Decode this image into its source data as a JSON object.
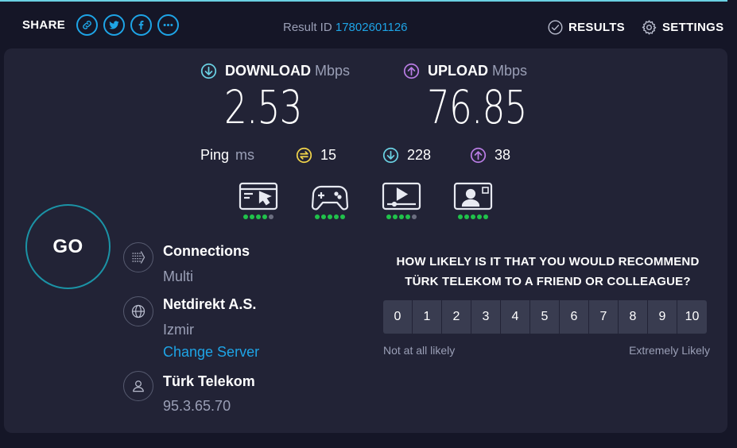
{
  "header": {
    "share_label": "SHARE",
    "share_buttons": [
      "link-icon",
      "twitter-icon",
      "facebook-icon",
      "more-icon"
    ],
    "result_id_label": "Result ID",
    "result_id": "17802601126",
    "results_label": "RESULTS",
    "settings_label": "SETTINGS"
  },
  "download": {
    "label": "DOWNLOAD",
    "unit": "Mbps",
    "value": "2.53",
    "icon": "download-arrow-icon",
    "color": "#6ad1e3"
  },
  "upload": {
    "label": "UPLOAD",
    "unit": "Mbps",
    "value": "76.85",
    "icon": "upload-arrow-icon",
    "color": "#b87ce3"
  },
  "ping": {
    "label": "Ping",
    "unit": "ms",
    "idle": "15",
    "download": "228",
    "upload": "38",
    "idle_color": "#f1d44a"
  },
  "use_cases": [
    {
      "icon": "browsing-icon",
      "rating": 4,
      "max": 5
    },
    {
      "icon": "gaming-icon",
      "rating": 5,
      "max": 5
    },
    {
      "icon": "video-streaming-icon",
      "rating": 4,
      "max": 5
    },
    {
      "icon": "video-chat-icon",
      "rating": 5,
      "max": 5
    }
  ],
  "go_label": "GO",
  "connections": {
    "title": "Connections",
    "value": "Multi"
  },
  "server": {
    "name": "Netdirekt A.S.",
    "location": "Izmir",
    "change_label": "Change Server"
  },
  "provider": {
    "name": "Türk Telekom",
    "ip": "95.3.65.70"
  },
  "nps": {
    "question_line1": "HOW LIKELY IS IT THAT YOU WOULD RECOMMEND",
    "question_line2": "TÜRK TELEKOM TO A FRIEND OR COLLEAGUE?",
    "scale": [
      "0",
      "1",
      "2",
      "3",
      "4",
      "5",
      "6",
      "7",
      "8",
      "9",
      "10"
    ],
    "low_label": "Not at all likely",
    "high_label": "Extremely Likely"
  },
  "colors": {
    "background": "#151627",
    "panel": "#222336",
    "accent": "#1ea4e6",
    "rating_on": "#20c24b"
  }
}
